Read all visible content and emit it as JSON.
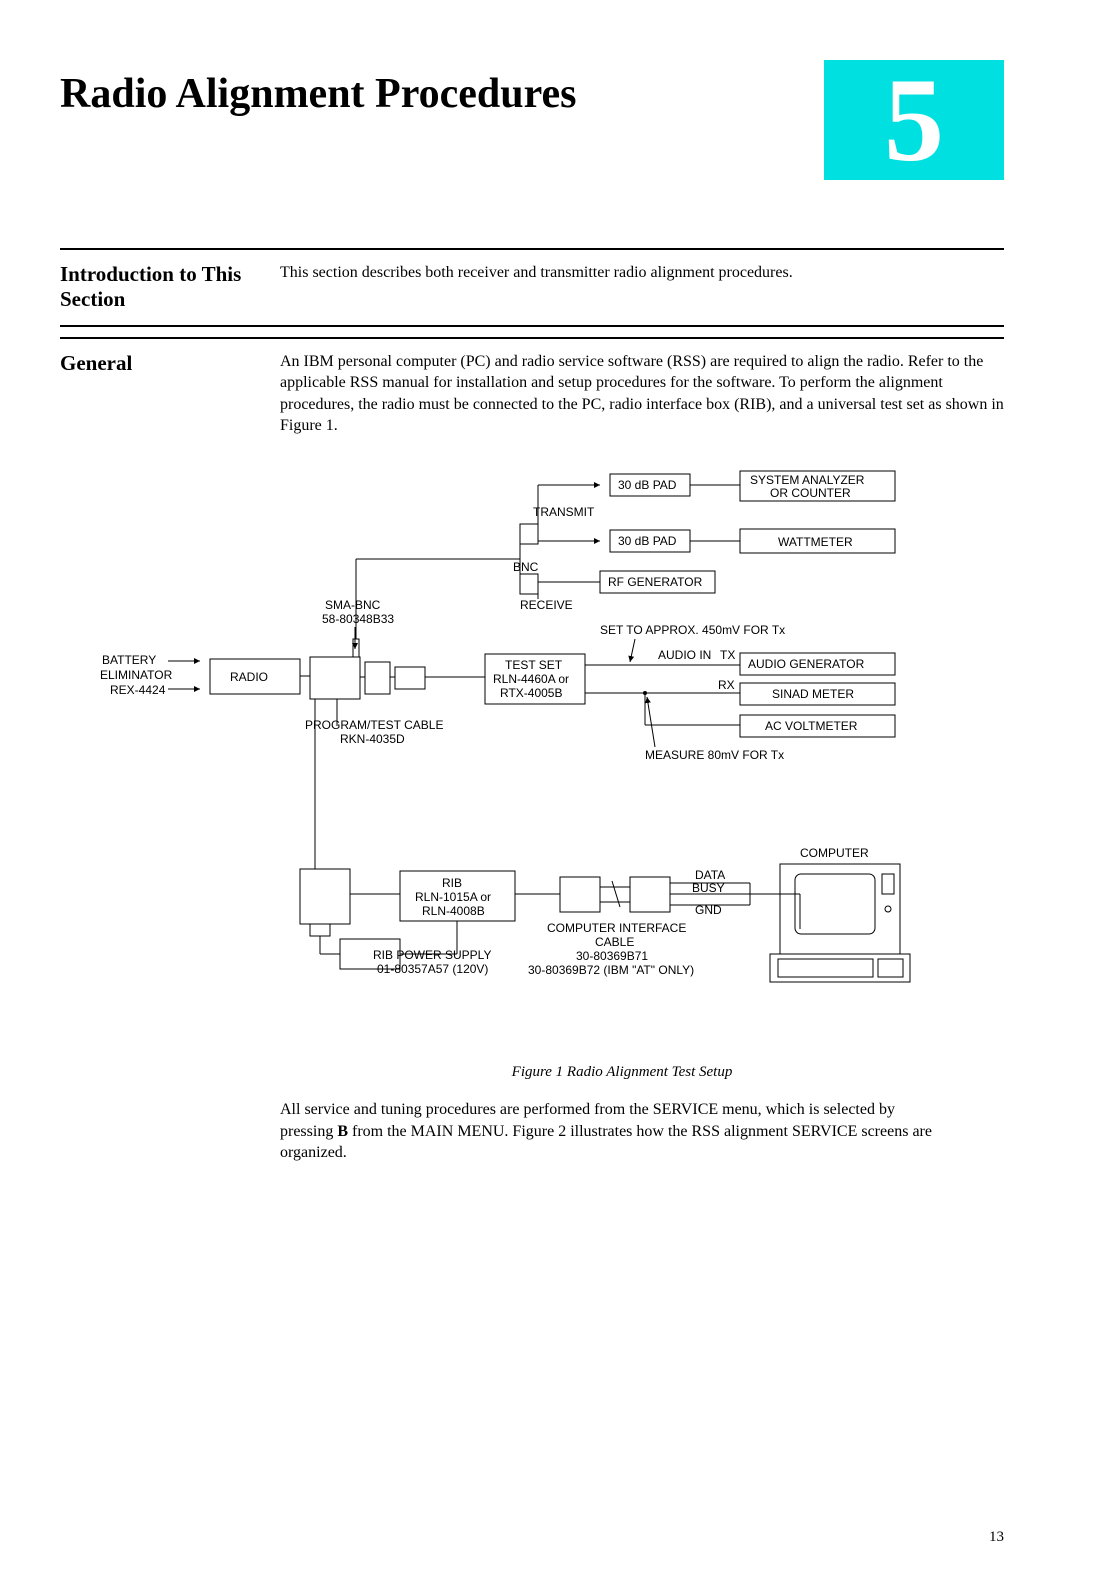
{
  "chapter": {
    "number": "5",
    "title": "Radio Alignment Procedures"
  },
  "sections": {
    "intro": {
      "heading": "Introduction to This Section",
      "body": "This section describes both receiver and transmitter radio alignment procedures."
    },
    "general": {
      "heading": "General",
      "body": "An IBM personal computer (PC) and radio service software (RSS) are required to align the radio. Refer to the applicable RSS manual for installation and setup procedures for the software. To perform the alignment procedures, the radio must be connected to the PC, radio interface box (RIB), and a universal test set as shown in Figure 1."
    }
  },
  "diagram": {
    "battery_label": "BATTERY",
    "eliminator_label": "ELIMINATOR",
    "rex_label": "REX-4424",
    "radio_label": "RADIO",
    "sma_bnc_label": "SMA-BNC",
    "sma_bnc_part": "58-80348B33",
    "program_cable_label": "PROGRAM/TEST CABLE",
    "program_cable_part": "RKN-4035D",
    "test_set_label": "TEST SET",
    "test_set_part1": "RLN-4460A or",
    "test_set_part2": "RTX-4005B",
    "transmit_label": "TRANSMIT",
    "receive_label": "RECEIVE",
    "bnc_label": "BNC",
    "pad1_label": "30 dB PAD",
    "pad2_label": "30 dB PAD",
    "analyzer_label1": "SYSTEM ANALYZER",
    "analyzer_label2": "OR COUNTER",
    "wattmeter_label": "WATTMETER",
    "rf_gen_label": "RF GENERATOR",
    "set_approx_label": "SET TO APPROX. 450mV FOR Tx",
    "audio_in_label": "AUDIO IN",
    "tx_label": "TX",
    "rx_label": "RX",
    "audio_gen_label": "AUDIO GENERATOR",
    "sinad_label": "SINAD METER",
    "ac_volt_label": "AC VOLTMETER",
    "measure_label": "MEASURE 80mV FOR Tx",
    "rib_label": "RIB",
    "rib_part1": "RLN-1015A or",
    "rib_part2": "RLN-4008B",
    "rib_power_label": "RIB POWER SUPPLY",
    "rib_power_part": "01-80357A57 (120V)",
    "comp_iface_label1": "COMPUTER INTERFACE",
    "comp_iface_label2": "CABLE",
    "comp_iface_part1": "30-80369B71",
    "comp_iface_part2": "30-80369B72 (IBM \"AT\" ONLY)",
    "data_label": "DATA",
    "busy_label": "BUSY",
    "gnd_label": "GND",
    "computer_label": "COMPUTER"
  },
  "figure_caption": "Figure 1 Radio Alignment Test Setup",
  "after_figure": {
    "text1": "All service and tuning procedures are performed from the SERVICE menu, which is selected by pressing ",
    "key": "B",
    "text2": " from the MAIN MENU. Figure 2 illustrates how the RSS alignment SERVICE screens are organized."
  },
  "page_number": "13"
}
